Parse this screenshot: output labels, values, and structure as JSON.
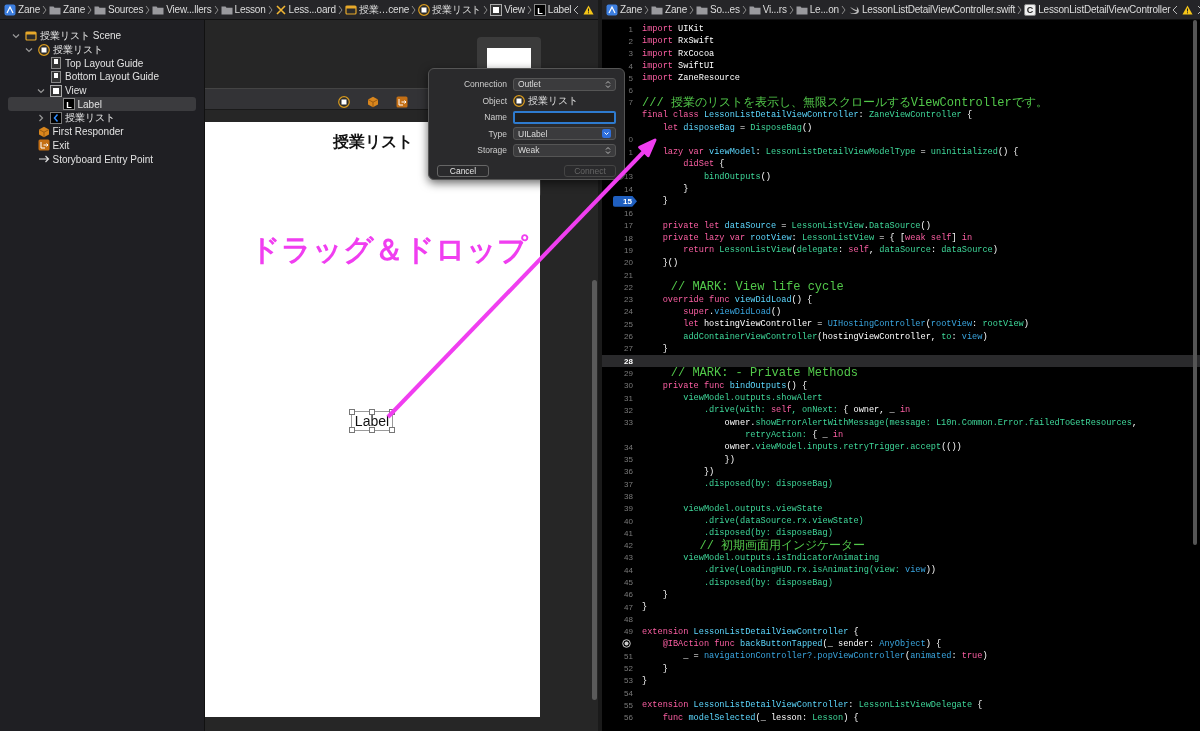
{
  "left_jump_bar": {
    "items": [
      {
        "kind": "app",
        "label": "Zane"
      },
      {
        "kind": "folder",
        "label": "Zane"
      },
      {
        "kind": "folder",
        "label": "Sources"
      },
      {
        "kind": "folder",
        "label": "View...llers"
      },
      {
        "kind": "folder",
        "label": "Lesson"
      },
      {
        "kind": "storyboard",
        "label": "Less...oard"
      },
      {
        "kind": "scene",
        "label": "授業…cene"
      },
      {
        "kind": "controller",
        "label": "授業リスト"
      },
      {
        "kind": "view",
        "label": "View"
      },
      {
        "kind": "label",
        "label": "Label",
        "glyph": "L"
      }
    ]
  },
  "outline": {
    "items": [
      {
        "kind": "scene",
        "label": "授業リスト Scene",
        "expanded": true,
        "selected": false,
        "children": [
          {
            "kind": "controller",
            "label": "授業リスト",
            "expanded": true,
            "selected": false,
            "children": [
              {
                "kind": "guide",
                "label": "Top Layout Guide",
                "selected": false
              },
              {
                "kind": "guide",
                "label": "Bottom Layout Guide",
                "selected": false
              },
              {
                "kind": "view",
                "label": "View",
                "expanded": true,
                "selected": false,
                "children": [
                  {
                    "kind": "label",
                    "label": "Label",
                    "glyph": "L",
                    "selected": true
                  }
                ]
              },
              {
                "kind": "navitem",
                "label": "授業リスト",
                "expanded": false,
                "selected": false
              }
            ]
          },
          {
            "kind": "responder",
            "label": "First Responder",
            "selected": false
          },
          {
            "kind": "exit",
            "label": "Exit",
            "selected": false
          },
          {
            "kind": "entry",
            "label": "Storyboard Entry Point",
            "selected": false
          }
        ]
      }
    ]
  },
  "canvas": {
    "scene_title": "授業リスト",
    "label_view": {
      "text": "Label",
      "selected": true
    },
    "annotation": "ドラッグ＆ドロップ"
  },
  "connection_popup": {
    "rows": [
      {
        "kind": "popup",
        "label": "Connection",
        "value": "Outlet"
      },
      {
        "kind": "object",
        "label": "Object",
        "value": "授業リスト"
      },
      {
        "kind": "input",
        "label": "Name",
        "focused": true
      },
      {
        "kind": "combo",
        "label": "Type",
        "value": "UILabel"
      },
      {
        "kind": "popup",
        "label": "Storage",
        "value": "Weak"
      }
    ],
    "buttons": [
      {
        "label": "Cancel",
        "disabled": false
      },
      {
        "label": "Connect",
        "disabled": true
      }
    ]
  },
  "right_jump_bar": {
    "items": [
      {
        "kind": "app",
        "label": "Zane"
      },
      {
        "kind": "folder",
        "label": "Zane"
      },
      {
        "kind": "folder",
        "label": "So...es"
      },
      {
        "kind": "folder",
        "label": "Vi...rs"
      },
      {
        "kind": "folder",
        "label": "Le...on"
      },
      {
        "kind": "swift",
        "label": "LessonListDetailViewController.swift"
      },
      {
        "kind": "class",
        "label": "LessonListDetailViewController",
        "glyph": "C"
      }
    ]
  },
  "editor": {
    "lines": [
      {
        "number": "1",
        "current": false,
        "tokens": [
          {
            "kind": "kw",
            "text": "import"
          },
          {
            "kind": "pl",
            "text": " UIKit"
          }
        ]
      },
      {
        "number": "2",
        "current": false,
        "tokens": [
          {
            "kind": "kw",
            "text": "import"
          },
          {
            "kind": "pl",
            "text": " RxSwift"
          }
        ]
      },
      {
        "number": "3",
        "current": false,
        "tokens": [
          {
            "kind": "kw",
            "text": "import"
          },
          {
            "kind": "pl",
            "text": " RxCocoa"
          }
        ]
      },
      {
        "number": "4",
        "current": false,
        "tokens": [
          {
            "kind": "kw",
            "text": "import"
          },
          {
            "kind": "pl",
            "text": " SwiftUI"
          }
        ]
      },
      {
        "number": "5",
        "current": false,
        "tokens": [
          {
            "kind": "kw",
            "text": "import"
          },
          {
            "kind": "pl",
            "text": " ZaneResource"
          }
        ]
      },
      {
        "number": "6",
        "current": false
      },
      {
        "number": "7",
        "current": false,
        "tokens": [
          {
            "kind": "cm",
            "text": "/// 授業のリストを表示し、無限スクロールするViewControllerです。"
          }
        ]
      },
      {
        "current": false,
        "tokens": [
          {
            "kind": "kw",
            "text": "final class "
          },
          {
            "kind": "decl",
            "text": "LessonListDetailViewController"
          },
          {
            "kind": "pl",
            "text": ": "
          },
          {
            "kind": "ty",
            "text": "ZaneViewController"
          },
          {
            "kind": "pl",
            "text": " {"
          }
        ]
      },
      {
        "current": false,
        "tokens": [
          {
            "kind": "kw",
            "text": "    let "
          },
          {
            "kind": "decl",
            "text": "disposeBag"
          },
          {
            "kind": "pl",
            "text": " = "
          },
          {
            "kind": "ty",
            "text": "DisposeBag"
          },
          {
            "kind": "pl",
            "text": "()"
          }
        ]
      },
      {
        "number": "0",
        "current": false
      },
      {
        "number": "1",
        "current": false,
        "tokens": [
          {
            "kind": "kw",
            "text": "    lazy var "
          },
          {
            "kind": "decl",
            "text": "viewModel"
          },
          {
            "kind": "pl",
            "text": ": "
          },
          {
            "kind": "ty",
            "text": "LessonListDetailViewModelType"
          },
          {
            "kind": "pl",
            "text": " = "
          },
          {
            "kind": "ty",
            "text": "uninitialized"
          },
          {
            "kind": "pl",
            "text": "() {"
          }
        ]
      },
      {
        "current": false,
        "tokens": [
          {
            "kind": "kw",
            "text": "        didSet"
          },
          {
            "kind": "pl",
            "text": " {"
          }
        ]
      },
      {
        "number": "13",
        "current": false,
        "tokens": [
          {
            "kind": "ty",
            "text": "            bindOutputs"
          },
          {
            "kind": "pl",
            "text": "()"
          }
        ]
      },
      {
        "number": "14",
        "current": false,
        "tokens": [
          {
            "kind": "pl",
            "text": "        }"
          }
        ]
      },
      {
        "number": "15",
        "current": false,
        "kind": "breakpoint",
        "tokens": [
          {
            "kind": "pl",
            "text": "    }"
          }
        ]
      },
      {
        "number": "16",
        "current": false
      },
      {
        "number": "17",
        "current": false,
        "tokens": [
          {
            "kind": "kw",
            "text": "    private let "
          },
          {
            "kind": "decl",
            "text": "dataSource"
          },
          {
            "kind": "pl",
            "text": " = "
          },
          {
            "kind": "ty",
            "text": "LessonListView"
          },
          {
            "kind": "pl",
            "text": "."
          },
          {
            "kind": "ty",
            "text": "DataSource"
          },
          {
            "kind": "pl",
            "text": "()"
          }
        ]
      },
      {
        "number": "18",
        "current": false,
        "tokens": [
          {
            "kind": "kw",
            "text": "    private lazy var "
          },
          {
            "kind": "decl",
            "text": "rootView"
          },
          {
            "kind": "pl",
            "text": ": "
          },
          {
            "kind": "ty",
            "text": "LessonListView"
          },
          {
            "kind": "pl",
            "text": " = { ["
          },
          {
            "kind": "kw",
            "text": "weak self"
          },
          {
            "kind": "pl",
            "text": "] "
          },
          {
            "kind": "kw",
            "text": "in"
          }
        ]
      },
      {
        "number": "19",
        "current": false,
        "tokens": [
          {
            "kind": "kw",
            "text": "        return "
          },
          {
            "kind": "ty",
            "text": "LessonListView"
          },
          {
            "kind": "pl",
            "text": "("
          },
          {
            "kind": "ty",
            "text": "delegate"
          },
          {
            "kind": "pl",
            "text": ": "
          },
          {
            "kind": "kw",
            "text": "self"
          },
          {
            "kind": "pl",
            "text": ", "
          },
          {
            "kind": "ty",
            "text": "dataSource"
          },
          {
            "kind": "pl",
            "text": ": "
          },
          {
            "kind": "ty",
            "text": "dataSource"
          },
          {
            "kind": "pl",
            "text": ")"
          }
        ]
      },
      {
        "number": "20",
        "current": false,
        "tokens": [
          {
            "kind": "pl",
            "text": "    }()"
          }
        ]
      },
      {
        "number": "21",
        "current": false
      },
      {
        "number": "22",
        "current": false,
        "tokens": [
          {
            "kind": "cm",
            "text": "    // MARK: View life cycle"
          }
        ]
      },
      {
        "number": "23",
        "current": false,
        "tokens": [
          {
            "kind": "kw",
            "text": "    override func "
          },
          {
            "kind": "decl",
            "text": "viewDidLoad"
          },
          {
            "kind": "pl",
            "text": "() {"
          }
        ]
      },
      {
        "number": "24",
        "current": false,
        "tokens": [
          {
            "kind": "kw",
            "text": "        super"
          },
          {
            "kind": "pl",
            "text": "."
          },
          {
            "kind": "sys",
            "text": "viewDidLoad"
          },
          {
            "kind": "pl",
            "text": "()"
          }
        ]
      },
      {
        "number": "25",
        "current": false,
        "tokens": [
          {
            "kind": "kw",
            "text": "        let "
          },
          {
            "kind": "pl",
            "text": "hostingViewController = "
          },
          {
            "kind": "sys",
            "text": "UIHostingController"
          },
          {
            "kind": "pl",
            "text": "("
          },
          {
            "kind": "sys",
            "text": "rootView"
          },
          {
            "kind": "pl",
            "text": ": "
          },
          {
            "kind": "ty",
            "text": "rootView"
          },
          {
            "kind": "pl",
            "text": ")"
          }
        ]
      },
      {
        "number": "26",
        "current": false,
        "tokens": [
          {
            "kind": "ty",
            "text": "        addContainerViewController"
          },
          {
            "kind": "pl",
            "text": "(hostingViewController, "
          },
          {
            "kind": "ty",
            "text": "to"
          },
          {
            "kind": "pl",
            "text": ": "
          },
          {
            "kind": "sys",
            "text": "view"
          },
          {
            "kind": "pl",
            "text": ")"
          }
        ]
      },
      {
        "number": "27",
        "current": false,
        "tokens": [
          {
            "kind": "pl",
            "text": "    }"
          }
        ]
      },
      {
        "number": "28",
        "current": true
      },
      {
        "number": "29",
        "current": false,
        "tokens": [
          {
            "kind": "cm",
            "text": "    // MARK: - Private Methods"
          }
        ]
      },
      {
        "number": "30",
        "current": false,
        "tokens": [
          {
            "kind": "kw",
            "text": "    private func "
          },
          {
            "kind": "decl",
            "text": "bindOutputs"
          },
          {
            "kind": "pl",
            "text": "() {"
          }
        ]
      },
      {
        "number": "31",
        "current": false,
        "tokens": [
          {
            "kind": "ty",
            "text": "        viewModel.outputs.showAlert"
          }
        ]
      },
      {
        "number": "32",
        "current": false,
        "tokens": [
          {
            "kind": "ty",
            "text": "            .drive(with: "
          },
          {
            "kind": "kw",
            "text": "self"
          },
          {
            "kind": "ty",
            "text": ", onNext: "
          },
          {
            "kind": "pl",
            "text": "{ owner, _ "
          },
          {
            "kind": "kw",
            "text": "in"
          }
        ]
      },
      {
        "number": "33",
        "current": false,
        "tokens": [
          {
            "kind": "pl",
            "text": "                owner."
          },
          {
            "kind": "ty",
            "text": "showErrorAlertWithMessage(message: L10n.Common.Error.failedToGetResources"
          },
          {
            "kind": "pl",
            "text": ","
          }
        ],
        "wrap": [
          {
            "kind": "ty",
            "text": "                    retryAction: "
          },
          {
            "kind": "pl",
            "text": "{ _ "
          },
          {
            "kind": "kw",
            "text": "in"
          }
        ]
      },
      {
        "number": "34",
        "current": false,
        "tokens": [
          {
            "kind": "pl",
            "text": "                owner."
          },
          {
            "kind": "ty",
            "text": "viewModel.inputs.retryTrigger.accept"
          },
          {
            "kind": "pl",
            "text": "(())"
          }
        ]
      },
      {
        "number": "35",
        "current": false,
        "tokens": [
          {
            "kind": "pl",
            "text": "                })"
          }
        ]
      },
      {
        "number": "36",
        "current": false,
        "tokens": [
          {
            "kind": "pl",
            "text": "            })"
          }
        ]
      },
      {
        "number": "37",
        "current": false,
        "tokens": [
          {
            "kind": "ty",
            "text": "            .disposed(by: disposeBag)"
          }
        ]
      },
      {
        "number": "38",
        "current": false
      },
      {
        "number": "39",
        "current": false,
        "tokens": [
          {
            "kind": "ty",
            "text": "        viewModel.outputs.viewState"
          }
        ]
      },
      {
        "number": "40",
        "current": false,
        "tokens": [
          {
            "kind": "ty",
            "text": "            .drive(dataSource.rx.viewState)"
          }
        ]
      },
      {
        "number": "41",
        "current": false,
        "tokens": [
          {
            "kind": "ty",
            "text": "            .disposed(by: disposeBag)"
          }
        ]
      },
      {
        "number": "42",
        "current": false,
        "tokens": [
          {
            "kind": "cm",
            "text": "        // 初期画面用インジケーター"
          }
        ]
      },
      {
        "number": "43",
        "current": false,
        "tokens": [
          {
            "kind": "ty",
            "text": "        viewModel.outputs.isIndicatorAnimating"
          }
        ]
      },
      {
        "number": "44",
        "current": false,
        "tokens": [
          {
            "kind": "ty",
            "text": "            .drive(LoadingHUD.rx.isAnimating(view: "
          },
          {
            "kind": "sys",
            "text": "view"
          },
          {
            "kind": "pl",
            "text": "))"
          }
        ]
      },
      {
        "number": "45",
        "current": false,
        "tokens": [
          {
            "kind": "ty",
            "text": "            .disposed(by: disposeBag)"
          }
        ]
      },
      {
        "number": "46",
        "current": false,
        "tokens": [
          {
            "kind": "pl",
            "text": "    }"
          }
        ]
      },
      {
        "number": "47",
        "current": false,
        "tokens": [
          {
            "kind": "pl",
            "text": "}"
          }
        ]
      },
      {
        "number": "48",
        "current": false
      },
      {
        "number": "49",
        "current": false,
        "tokens": [
          {
            "kind": "kw",
            "text": "extension "
          },
          {
            "kind": "decl",
            "text": "LessonListDetailViewController"
          },
          {
            "kind": "pl",
            "text": " {"
          }
        ]
      },
      {
        "current": false,
        "kind": "connection",
        "tokens": [
          {
            "kind": "kw",
            "text": "    @IBAction func "
          },
          {
            "kind": "decl",
            "text": "backButtonTapped"
          },
          {
            "kind": "pl",
            "text": "(_ sender: "
          },
          {
            "kind": "sys",
            "text": "AnyObject"
          },
          {
            "kind": "pl",
            "text": ") {"
          }
        ]
      },
      {
        "number": "51",
        "current": false,
        "tokens": [
          {
            "kind": "pl",
            "text": "        _ = "
          },
          {
            "kind": "sys",
            "text": "navigationController?.popViewController"
          },
          {
            "kind": "pl",
            "text": "("
          },
          {
            "kind": "sys",
            "text": "animated"
          },
          {
            "kind": "pl",
            "text": ": "
          },
          {
            "kind": "kw",
            "text": "true"
          },
          {
            "kind": "pl",
            "text": ")"
          }
        ]
      },
      {
        "number": "52",
        "current": false,
        "tokens": [
          {
            "kind": "pl",
            "text": "    }"
          }
        ]
      },
      {
        "number": "53",
        "current": false,
        "tokens": [
          {
            "kind": "pl",
            "text": "}"
          }
        ]
      },
      {
        "number": "54",
        "current": false
      },
      {
        "number": "55",
        "current": false,
        "tokens": [
          {
            "kind": "kw",
            "text": "extension "
          },
          {
            "kind": "decl",
            "text": "LessonListDetailViewController"
          },
          {
            "kind": "pl",
            "text": ": "
          },
          {
            "kind": "ty",
            "text": "LessonListViewDelegate"
          },
          {
            "kind": "pl",
            "text": " {"
          }
        ]
      },
      {
        "number": "56",
        "current": false,
        "tokens": [
          {
            "kind": "kw",
            "text": "    func "
          },
          {
            "kind": "decl",
            "text": "modelSelected"
          },
          {
            "kind": "pl",
            "text": "(_ lesson: "
          },
          {
            "kind": "ty",
            "text": "Lesson"
          },
          {
            "kind": "pl",
            "text": ") {"
          }
        ]
      }
    ]
  }
}
